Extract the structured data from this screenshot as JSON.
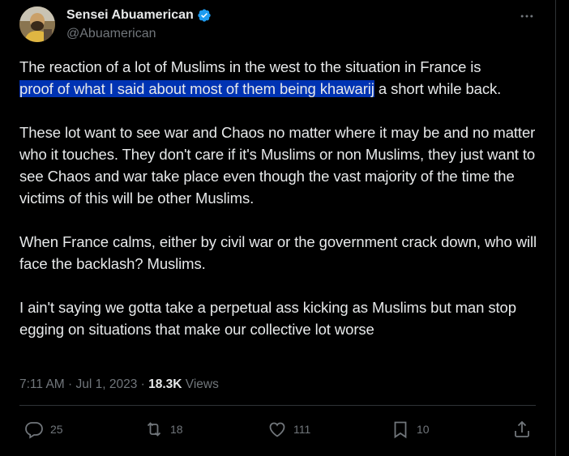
{
  "author": {
    "display_name": "Sensei Abuamerican",
    "handle": "@Abuamerican"
  },
  "tweet": {
    "line1_before": "The reaction of a lot of Muslims in the west to the situation in France is",
    "highlight": "proof of what I said about most of them being khawarij",
    "line2_after": " a short while back.",
    "paragraph2": "These lot want to see war and Chaos no matter where it may be and no matter who it touches. They don't care if it's Muslims or non Muslims, they just want to see Chaos and war take place even though the vast majority of the time the victims of this will be other Muslims.",
    "paragraph3": "When France calms, either by civil war or the government crack down, who will face the backlash? Muslims.",
    "paragraph4": "I ain't saying we gotta take a perpetual ass kicking as Muslims but man stop egging on situations that make our collective lot worse"
  },
  "meta": {
    "time": "7:11 AM",
    "sep1": " · ",
    "date": "Jul 1, 2023",
    "sep2": " · ",
    "views_count": "18.3K",
    "views_label": " Views"
  },
  "actions": {
    "replies": "25",
    "retweets": "18",
    "likes": "111",
    "bookmarks": "10"
  },
  "colors": {
    "background": "#000000",
    "text": "#e7e9ea",
    "muted": "#71767b",
    "verified": "#1d9bf0",
    "highlight": "#0033b3"
  }
}
